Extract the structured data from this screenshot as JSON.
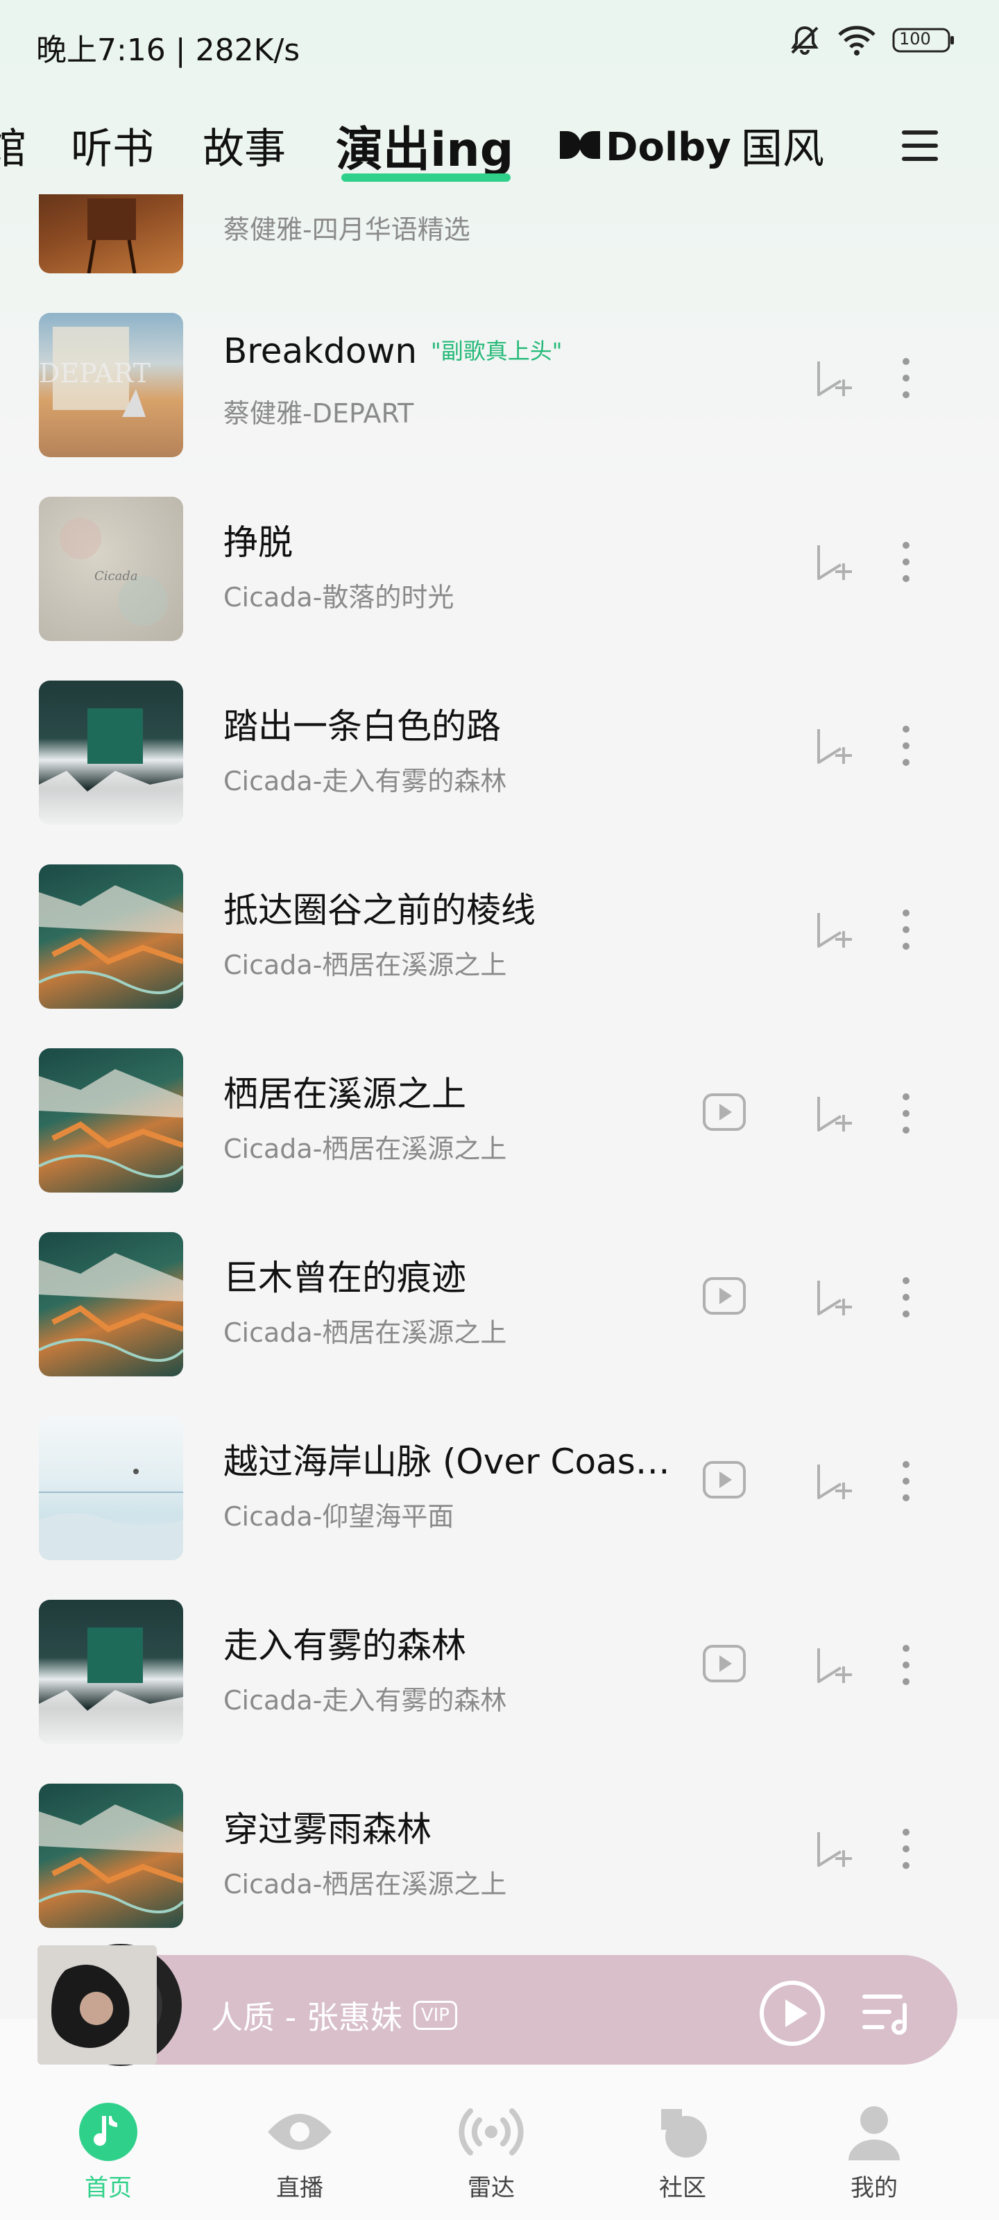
{
  "status_bar": {
    "time": "晚上7:16 | 282K/s",
    "battery": "100",
    "icons": [
      "mute-icon",
      "wifi-icon",
      "battery-icon"
    ]
  },
  "tabs": {
    "partial_left": "馆",
    "items": [
      {
        "label": "听书"
      },
      {
        "label": "故事"
      },
      {
        "label": "演出ing",
        "active": true
      },
      {
        "label": "Dolby"
      },
      {
        "label": "国风"
      }
    ],
    "menu_icon": "hamburger-icon"
  },
  "songs": [
    {
      "title": "",
      "subtitle": "蔡健雅-四月华语精选",
      "has_video": false
    },
    {
      "title": "Breakdown",
      "tag": "\"副歌真上头\"",
      "subtitle": "蔡健雅-DEPART",
      "has_video": false
    },
    {
      "title": "挣脱",
      "subtitle": "Cicada-散落的时光",
      "has_video": false
    },
    {
      "title": "踏出一条白色的路",
      "subtitle": "Cicada-走入有雾的森林",
      "has_video": false
    },
    {
      "title": "抵达圈谷之前的棱线",
      "subtitle": "Cicada-栖居在溪源之上",
      "has_video": false
    },
    {
      "title": "栖居在溪源之上",
      "subtitle": "Cicada-栖居在溪源之上",
      "has_video": true
    },
    {
      "title": "巨木曾在的痕迹",
      "subtitle": "Cicada-栖居在溪源之上",
      "has_video": true
    },
    {
      "title": "越过海岸山脉 (Over Coast…",
      "subtitle": "Cicada-仰望海平面",
      "has_video": true
    },
    {
      "title": "走入有雾的森林",
      "subtitle": "Cicada-走入有雾的森林",
      "has_video": true
    },
    {
      "title": "穿过雾雨森林",
      "subtitle": "Cicada-栖居在溪源之上",
      "has_video": false
    }
  ],
  "mini_player": {
    "title": "人质 - 张惠妹",
    "badge": "VIP"
  },
  "bottom_nav": [
    {
      "label": "首页",
      "icon": "music-note-icon",
      "active": true
    },
    {
      "label": "直播",
      "icon": "eye-icon"
    },
    {
      "label": "雷达",
      "icon": "radar-icon"
    },
    {
      "label": "社区",
      "icon": "community-icon"
    },
    {
      "label": "我的",
      "icon": "user-icon"
    }
  ],
  "colors": {
    "accent": "#2fd18a",
    "tag_green": "#24b978",
    "mini_player_bg": "#d8bfca"
  }
}
